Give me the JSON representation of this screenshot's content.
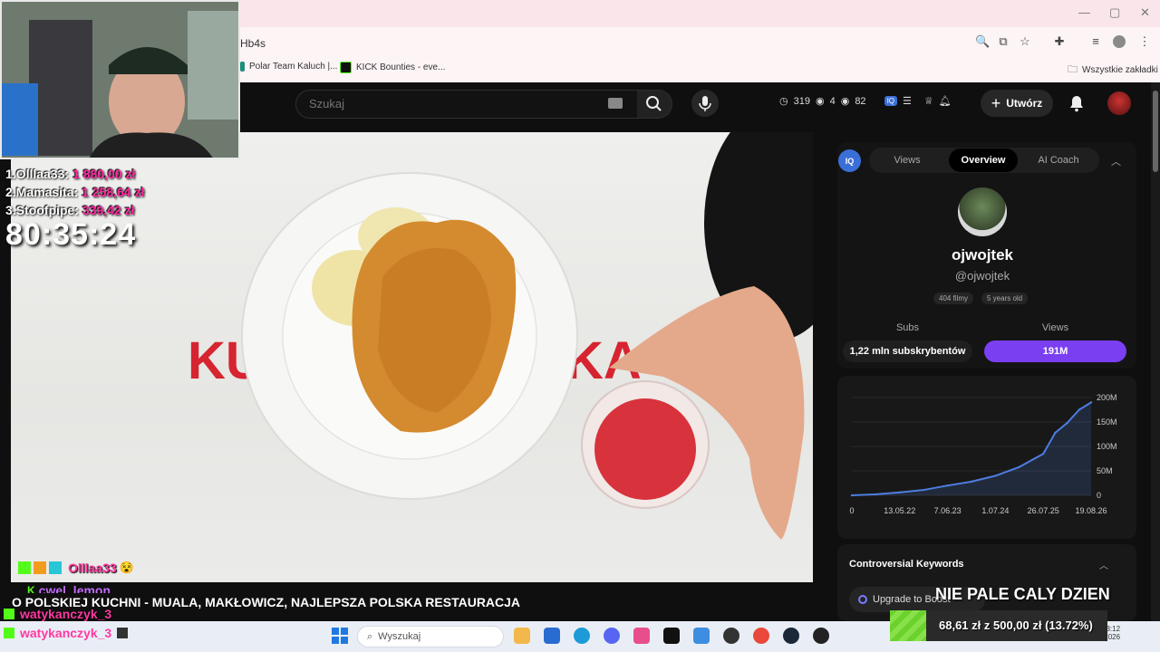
{
  "browser": {
    "url_fragment": "Hb4s",
    "bookmarks": [
      "Polar Team Kaluch |...",
      "KICK Bounties - eve..."
    ],
    "all_bookmarks": "Wszystkie zakładki"
  },
  "youtube": {
    "search_placeholder": "Szukaj",
    "stats": {
      "a": "319",
      "b": "4",
      "c": "82"
    },
    "create_label": "Utwórz"
  },
  "sidebar": {
    "tabs": [
      "Views",
      "Overview",
      "AI Coach"
    ],
    "active_tab": "Overview",
    "channel_name": "ojwojtek",
    "handle": "@ojwojtek",
    "films_badge": "404 filmy",
    "age_badge": "5 years old",
    "subs_label": "Subs",
    "views_label": "Views",
    "subs_value": "1,22 mln subskrybentów",
    "views_value": "191M",
    "section_title": "Controversial Keywords",
    "upgrade_label": "Upgrade to Boost"
  },
  "chart_data": {
    "type": "area",
    "x_ticks": [
      "0",
      "13.05.22",
      "7.06.23",
      "1.07.24",
      "26.07.25",
      "19.08.26"
    ],
    "y_ticks": [
      "0",
      "50M",
      "100M",
      "150M",
      "200M"
    ],
    "ylim": [
      0,
      200
    ],
    "x": [
      0,
      0.5,
      1,
      1.5,
      2,
      2.5,
      3,
      3.5,
      4,
      4.25,
      4.5,
      4.75,
      5
    ],
    "y": [
      0,
      2,
      6,
      11,
      20,
      28,
      40,
      58,
      85,
      128,
      148,
      175,
      190
    ],
    "color": "#4d7de0"
  },
  "overlay": {
    "donors": [
      {
        "name": "1.Olllaa33:",
        "amount": "1 880,00 zł"
      },
      {
        "name": "2.Mamasita:",
        "amount": "1 258,64 zł"
      },
      {
        "name": "3.Stoofpipe:",
        "amount": "339,42 zł"
      }
    ],
    "timer": "80:35:24",
    "chat": [
      {
        "name": "Olllaa33",
        "color": "#ff3aa1"
      },
      {
        "name": "cwel_lemon",
        "color": "#c36cff"
      },
      {
        "name": "watykanczyk_3",
        "color": "#ff3aa1"
      },
      {
        "name": "watykanczyk_3",
        "color": "#ff3aa1"
      }
    ],
    "video_title": "O POLSKIEJ KUCHNI - MUALA, MAKŁOWICZ, NAJLEPSZA POLSKA RESTAURACJA",
    "stream_text": "NIE PALE CALY DZIEN",
    "goal": "68,61 zł z 500,00 zł (13.72%)",
    "goal_fraction": 0.1372
  },
  "video_text": {
    "left": "KU",
    "right": "KA"
  },
  "taskbar": {
    "search_placeholder": "Wyszukaj",
    "time": "23:12",
    "date": "19.08.2026"
  }
}
